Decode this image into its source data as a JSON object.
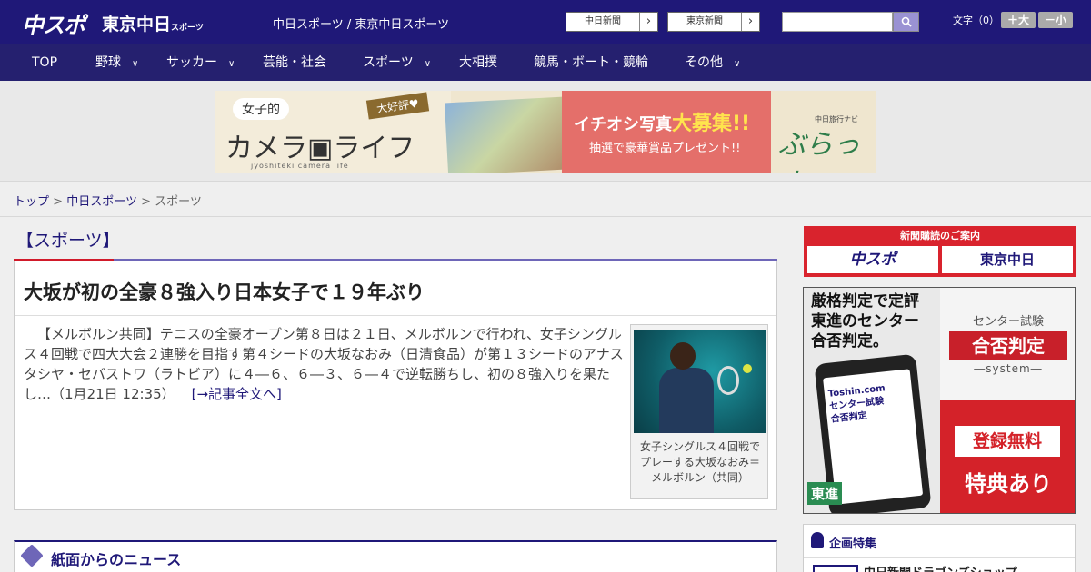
{
  "header": {
    "logo_primary": "中スポ",
    "logo_secondary": "東京中日",
    "logo_secondary_small": "スポーツ",
    "site_title": "中日スポーツ / 東京中日スポーツ",
    "paper_links": [
      {
        "label": "中日新聞",
        "arrow": "›"
      },
      {
        "label": "東京新聞",
        "arrow": "›"
      }
    ],
    "search": {
      "placeholder": "",
      "value": ""
    },
    "font_size": {
      "label": "文字（0）",
      "increase": "＋大",
      "decrease": "－小"
    }
  },
  "nav": {
    "items": [
      {
        "label": "TOP",
        "has_menu": false
      },
      {
        "label": "野球",
        "has_menu": true
      },
      {
        "label": "サッカー",
        "has_menu": true
      },
      {
        "label": "芸能・社会",
        "has_menu": false
      },
      {
        "label": "スポーツ",
        "has_menu": true
      },
      {
        "label": "大相撲",
        "has_menu": false
      },
      {
        "label": "競馬・ボート・競輪",
        "has_menu": false
      },
      {
        "label": "その他",
        "has_menu": true
      }
    ],
    "chevron": "∨"
  },
  "banner": {
    "joshi": "女子的",
    "camera_life": "カメラ▣ライフ",
    "romaji": "jyoshiteki camera life",
    "daikohyo": "大好評♥",
    "ichioshi_pre": "イチオシ写真",
    "ichioshi_big": "大募集!!",
    "chusen": "抽選で豪華賞品プレゼント!!",
    "navi": "中日旅行ナビ",
    "burari": "ぶらっ人"
  },
  "breadcrumb": {
    "items": [
      {
        "label": "トップ",
        "link": true
      },
      {
        "label": "中日スポーツ",
        "link": true
      },
      {
        "label": "スポーツ",
        "link": false
      }
    ],
    "separator": ">"
  },
  "section": {
    "title": "【スポーツ】"
  },
  "article": {
    "headline": "大坂が初の全豪８強入り日本女子で１９年ぶり",
    "body": "【メルボルン共同】テニスの全豪オープン第８日は２１日、メルボルンで行われ、女子シングルス４回戦で四大大会２連勝を目指す第４シードの大坂なおみ（日清食品）が第１３シードのアナスタシヤ・セバストワ（ラトビア）に４―６、６―３、６―４で逆転勝ちし、初の８強入りを果たし…（1月21日 12:35）",
    "more_link": "[→記事全文へ]",
    "photo_caption": "女子シングルス４回戦でプレーする大坂なおみ＝メルボルン（共同）"
  },
  "paper_news": {
    "title": "紙面からのニュース"
  },
  "sidebar": {
    "subscription": {
      "title": "新聞購読のご案内",
      "logo_left": "中スポ",
      "logo_right": "東京中日"
    },
    "center_ad": {
      "headline_lines": [
        "厳格判定で定評",
        "東進のセンター",
        "合否判定。"
      ],
      "phone_lines": [
        "Toshin.com",
        "センター試験",
        "合否判定"
      ],
      "brand": "東進",
      "center_label": "センター試験",
      "goh": "合否判定",
      "system": "―system―",
      "free": "登録無料",
      "perk": "特典あり"
    },
    "feature": {
      "title": "企画特集",
      "item": "中日新聞ドラゴンズショップ"
    }
  },
  "colors": {
    "header_bg": "#1f1878",
    "nav_bg": "#25206f",
    "accent_red": "#d11a2a",
    "section_rule": "#6e66b8"
  }
}
